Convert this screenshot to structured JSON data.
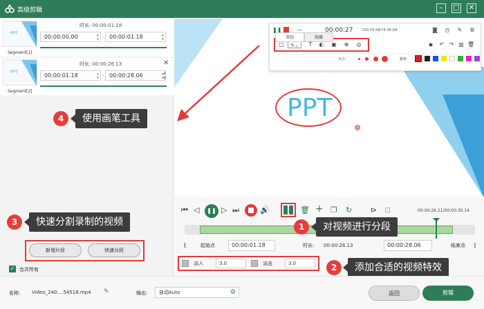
{
  "app": {
    "title": "高级剪辑"
  },
  "segments": [
    {
      "label": "Segment[1]",
      "duration": "时长: 00:00:01.18",
      "start": "00:00:00.00",
      "end": "00:00:01.18"
    },
    {
      "label": "Segment[2]",
      "duration": "时长: 00:00:26.13",
      "start": "00:00:01.18",
      "end": "00:00:28.06"
    }
  ],
  "thumb_text": "PPT",
  "callouts": [
    {
      "num": "4",
      "text": "使用画笔工具"
    },
    {
      "num": "3",
      "text": "快速分割录制的视频"
    },
    {
      "num": "1",
      "text": "对视频进行分段"
    },
    {
      "num": "2",
      "text": "添加合适的视频特效"
    }
  ],
  "left_buttons": {
    "new_segment": "新增片段",
    "quick_split": "快速分段"
  },
  "merge_all": "合并所有",
  "preview": {
    "ppt_text": "PPT"
  },
  "floating_toolbar": {
    "time": "00:00:27",
    "stats": "320.05 KB/74.48 GB",
    "tabs": [
      "添加",
      "隐藏"
    ],
    "size_label": "大小:",
    "color_label": "颜色"
  },
  "player": {
    "time": "00:00:26.21/00:00:30.14"
  },
  "cut": {
    "start_label": "起始点",
    "start_time": "00:00:01.18",
    "duration_label": "时长:",
    "duration_value": "00:00:26.13",
    "end_time": "00:00:28.06",
    "end_label": "结束点"
  },
  "effects": {
    "fade_in_label": "淡入",
    "fade_in_value": "3.0",
    "fade_out_label": "淡出",
    "fade_out_value": "3.0"
  },
  "footer": {
    "name_label": "名称:",
    "name_value": "Video_240....54518.mp4",
    "output_label": "输出:",
    "output_value": "自动Auto",
    "back_label": "返回",
    "edit_label": "剪辑"
  },
  "colors": {
    "brand": "#2e7d58",
    "annot": "#e23a3a",
    "callout_bg": "#3c3c3c"
  }
}
